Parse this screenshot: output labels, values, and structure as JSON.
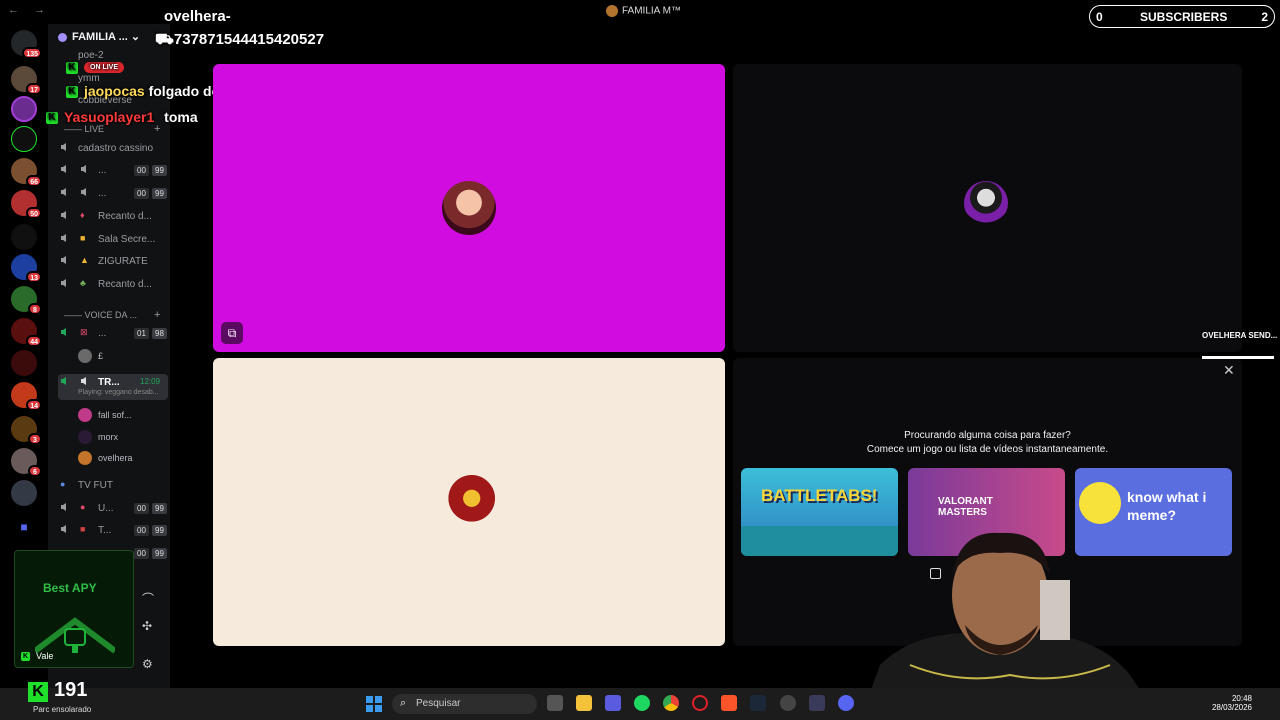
{
  "window": {
    "title": "FAMILIA M™"
  },
  "server_badges": [
    "135",
    "17",
    "66",
    "50",
    "13",
    "8",
    "44",
    "14",
    "3",
    "6"
  ],
  "guild": {
    "name": "FAMILIA ..."
  },
  "categories": {
    "live": "LIVE",
    "voice": "VOICE DA ..."
  },
  "top_channels": [
    "poe-2",
    "ymm",
    "cobbleverse"
  ],
  "channels": [
    {
      "label": "cadastro cassino"
    },
    {
      "label": "...",
      "c1": "00",
      "c2": "99"
    },
    {
      "label": "...",
      "c1": "00",
      "c2": "99"
    },
    {
      "label": "Recanto d..."
    },
    {
      "label": "Sala Secre..."
    },
    {
      "label": "ZIGURATE"
    },
    {
      "label": "Recanto d..."
    }
  ],
  "voice_channels": [
    {
      "label": "...",
      "c1": "01",
      "c2": "98"
    },
    {
      "label": "TR...",
      "time": "12:09",
      "sub": "Playing: veggano desab..."
    }
  ],
  "members": [
    "£",
    "fall sof...",
    "morx",
    "ovelhera"
  ],
  "more_channels": [
    {
      "label": "TV FUT"
    },
    {
      "label": "U...",
      "c1": "00",
      "c2": "99"
    },
    {
      "label": "T...",
      "c1": "00",
      "c2": "99"
    },
    {
      "label": "",
      "c1": "00",
      "c2": "99"
    }
  ],
  "chat": {
    "line0_name": "ovelhera-",
    "line0_text": "737871544415420527",
    "onlive": "ON LIVE",
    "line1_user": "jaopocas",
    "line1_text": "folgado do carai",
    "line2_user": "Yasuoplayer1",
    "line2_text": "toma"
  },
  "subscribers": {
    "left": "0",
    "label": "SUBSCRIBERS",
    "right": "2"
  },
  "sending": {
    "label": "OVELHERA SEND..."
  },
  "activity": {
    "q1": "Procurando alguma coisa para fazer?",
    "q2": "Comece um jogo ou lista de vídeos instantaneamente.",
    "cards": [
      "BATTLETABS!",
      "VALORANT MASTERS",
      "know what i meme?"
    ],
    "checkbox_suffix": "te"
  },
  "widget": {
    "title": "Best APY",
    "vale": "Vale"
  },
  "taskbar": {
    "weather_value": "191",
    "weather_text": "Parc ensolarado",
    "search_placeholder": "Pesquisar",
    "time": "20:48",
    "date": "28/03/2026"
  }
}
